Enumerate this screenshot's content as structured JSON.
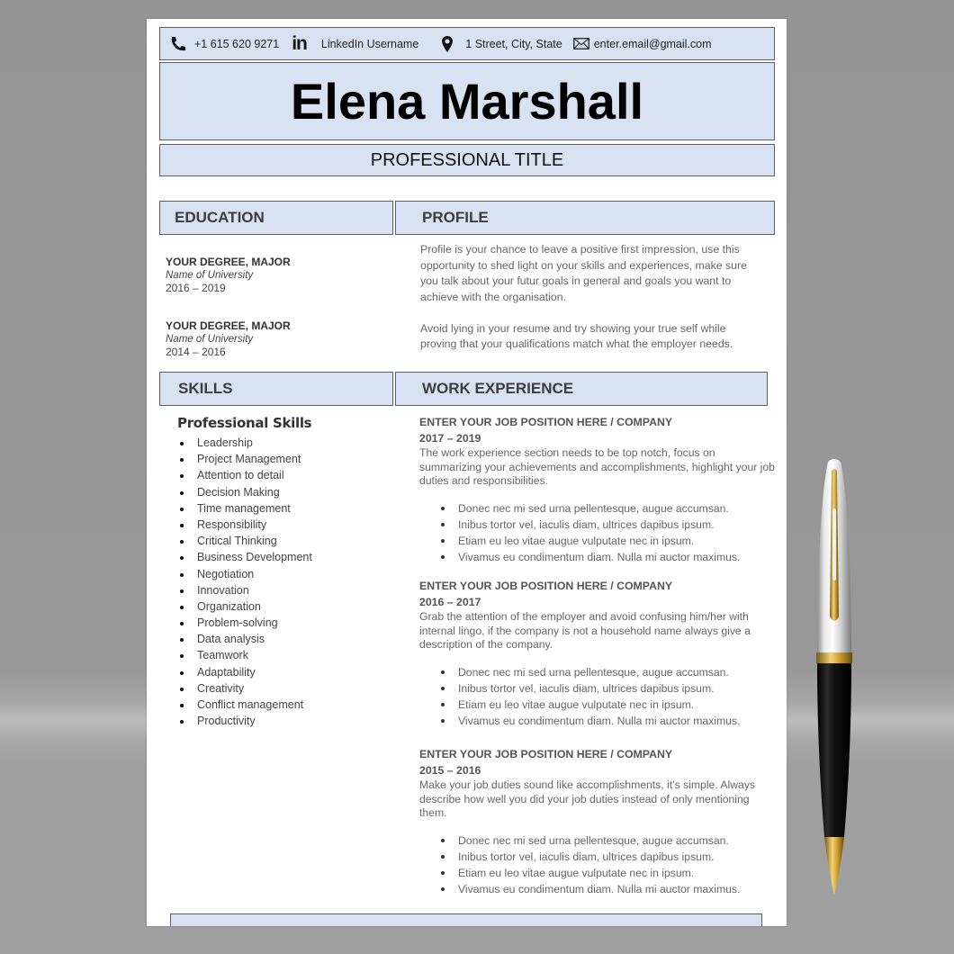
{
  "contact": {
    "phone": "+1 615 620 9271",
    "linkedin": "LinkedIn Username",
    "address": "1 Street, City, State",
    "email": "enter.email@gmail.com",
    "icons": [
      "phone-icon",
      "linkedin-icon",
      "location-pin-icon",
      "envelope-icon"
    ]
  },
  "header": {
    "name": "Elena Marshall",
    "title": "PROFESSIONAL TITLE"
  },
  "sections": {
    "education": "EDUCATION",
    "profile": "PROFILE",
    "skills": "SKILLS",
    "work": "WORK EXPERIENCE"
  },
  "education": [
    {
      "degree": "YOUR DEGREE, MAJOR",
      "university": "Name of University",
      "years": "2016 – 2019"
    },
    {
      "degree": "YOUR DEGREE, MAJOR",
      "university": "Name of University",
      "years": "2014 – 2016"
    }
  ],
  "profile": {
    "paragraphs": [
      "Profile is your chance to leave a positive first impression, use this opportunity to shed light on your skills and experiences, make sure you talk about your futur goals in general and goals you want to achieve with the organisation.",
      "Avoid lying in your resume and try showing your true self while proving that your qualifications match what the employer needs."
    ]
  },
  "skills": {
    "heading": "Professional Skills",
    "items": [
      "Leadership",
      "Project Management",
      "Attention to detail",
      "Decision Making",
      "Time management",
      "Responsibility",
      "Critical Thinking",
      "Business Development",
      "Negotiation",
      "Innovation",
      "Organization",
      "Problem-solving",
      "Data analysis",
      "Teamwork",
      "Adaptability",
      "Creativity",
      "Conflict management",
      "Productivity"
    ]
  },
  "jobs": [
    {
      "position": "ENTER YOUR JOB POSITION HERE / COMPANY",
      "years": "2017 – 2019",
      "description": "The work experience section needs to be top notch, focus on summarizing your achievements and accomplishments, highlight your job duties and responsibilities.",
      "bullets": [
        "Donec nec mi sed urna pellentesque, augue accumsan.",
        "Inibus tortor vel, iaculis diam, ultrices dapibus ipsum.",
        "Etiam eu leo vitae augue vulputate nec in ipsum.",
        "Vivamus eu condimentum diam. Nulla mi auctor maximus."
      ]
    },
    {
      "position": "ENTER YOUR JOB POSITION HERE / COMPANY",
      "years": "2016 – 2017",
      "description": "Grab the attention of the employer and avoid confusing him/her with internal lingo, if the company is not a household name always give a description of the company.",
      "bullets": [
        "Donec nec mi sed urna pellentesque, augue accumsan.",
        "Inibus tortor vel, iaculis diam, ultrices dapibus ipsum.",
        "Etiam eu leo vitae augue vulputate nec in ipsum.",
        "Vivamus eu condimentum diam. Nulla mi auctor maximus."
      ]
    },
    {
      "position": "ENTER YOUR JOB POSITION HERE / COMPANY",
      "years": "2015 – 2016",
      "description": "Make your job duties sound like accomplishments, it’s simple. Always describe how well you did your job duties instead of only mentioning them.",
      "bullets": [
        "Donec nec mi sed urna pellentesque, augue accumsan.",
        "Inibus tortor vel, iaculis diam, ultrices dapibus ipsum.",
        "Etiam eu leo vitae augue vulputate nec in ipsum.",
        "Vivamus eu condimentum diam. Nulla mi auctor maximus."
      ]
    }
  ],
  "colors": {
    "box_fill": "#d9e2f2",
    "box_border": "#5d5f66",
    "background": "#9a9a9a"
  },
  "decoration": {
    "pen": "ballpoint-pen-image"
  }
}
